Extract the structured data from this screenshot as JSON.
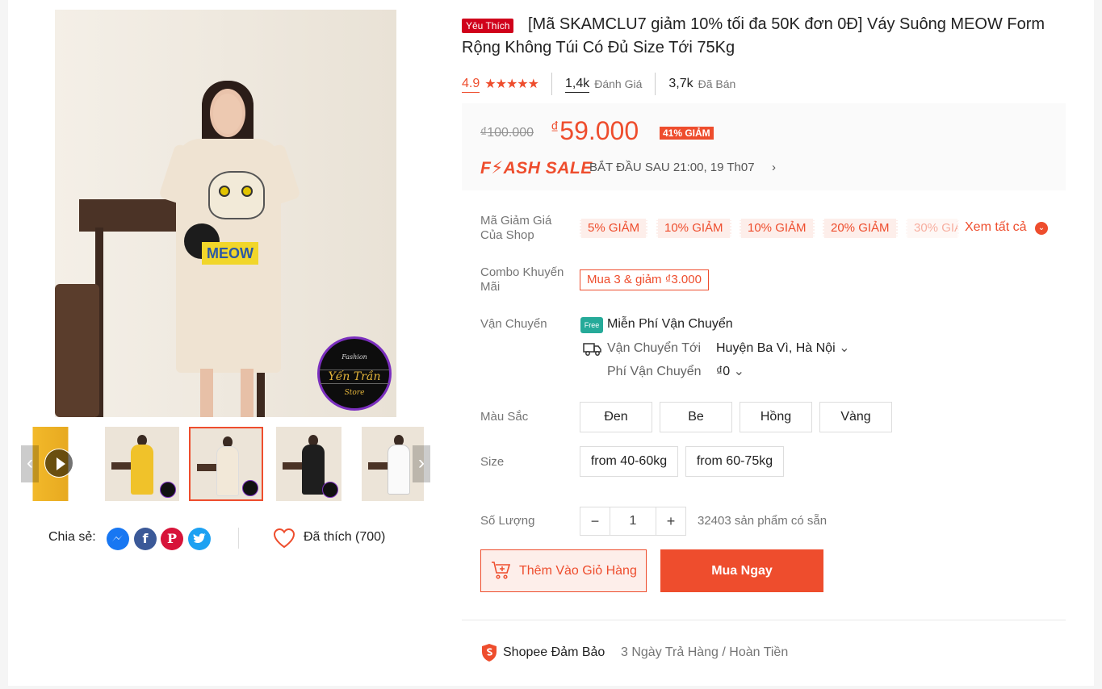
{
  "product": {
    "badge": "Yêu Thích",
    "title": "[Mã SKAMCLU7 giảm 10% tối đa 50K đơn 0Đ] Váy Suông MEOW Form Rộng Không Túi Có Đủ Size Tới 75Kg",
    "rating": "4.9",
    "stars": "★★★★★",
    "reviews_count": "1,4k",
    "reviews_label": "Đánh Giá",
    "sold_count": "3,7k",
    "sold_label": "Đã Bán"
  },
  "image": {
    "meow_text": "MEOW",
    "logo_line1": "Fashion",
    "logo_line2": "Yến Trần",
    "logo_line3": "Store"
  },
  "thumbnails": [
    "video",
    "yellow-dress",
    "beige-dress",
    "black-dress",
    "white-dress"
  ],
  "price": {
    "old": "₫100.000",
    "currency": "₫",
    "new": "59.000",
    "discount": "41% GIẢM",
    "flash_label": "F⚡ASH SALE",
    "flash_time": "BẮT ĐẦU SAU 21:00, 19 Th07",
    "chevron": "›"
  },
  "vouchers": {
    "label": "Mã Giảm Giá Của Shop",
    "items": [
      "5% GIẢM",
      "10% GIẢM",
      "10% GIẢM",
      "20% GIẢM",
      "30% GIẢ"
    ],
    "see_all": "Xem tất cả",
    "see_all_icon": "⌄"
  },
  "combo": {
    "label": "Combo Khuyến Mãi",
    "value": "Mua 3 & giảm ₫3.000"
  },
  "shipping": {
    "label": "Vận Chuyển",
    "free_icon_text": "Free",
    "free": "Miễn Phí Vận Chuyển",
    "to_label": "Vận Chuyển Tới",
    "to_value": "Huyện Ba Vì, Hà Nội",
    "fee_label": "Phí Vận Chuyển",
    "fee_value": "₫0",
    "dropdown_icon": "⌄"
  },
  "colors": {
    "label": "Màu Sắc",
    "options": [
      "Đen",
      "Be",
      "Hồng",
      "Vàng"
    ]
  },
  "sizes": {
    "label": "Size",
    "options": [
      "from 40-60kg",
      "from 60-75kg"
    ]
  },
  "quantity": {
    "label": "Số Lượng",
    "minus": "−",
    "value": "1",
    "plus": "+",
    "stock": "32403 sản phẩm có sẵn"
  },
  "actions": {
    "add_to_cart": "Thêm Vào Giỏ Hàng",
    "buy_now": "Mua Ngay"
  },
  "share": {
    "label": "Chia sẻ:",
    "liked": "Đã thích (700)"
  },
  "guarantee": {
    "title": "Shopee Đảm Bảo",
    "desc": "3 Ngày Trả Hàng / Hoàn Tiền"
  },
  "colors_theme": {
    "accent": "#ee4d2d",
    "messenger": "#1877f2",
    "facebook": "#3b5998",
    "pinterest": "#d7143a",
    "twitter": "#1da1f2"
  }
}
